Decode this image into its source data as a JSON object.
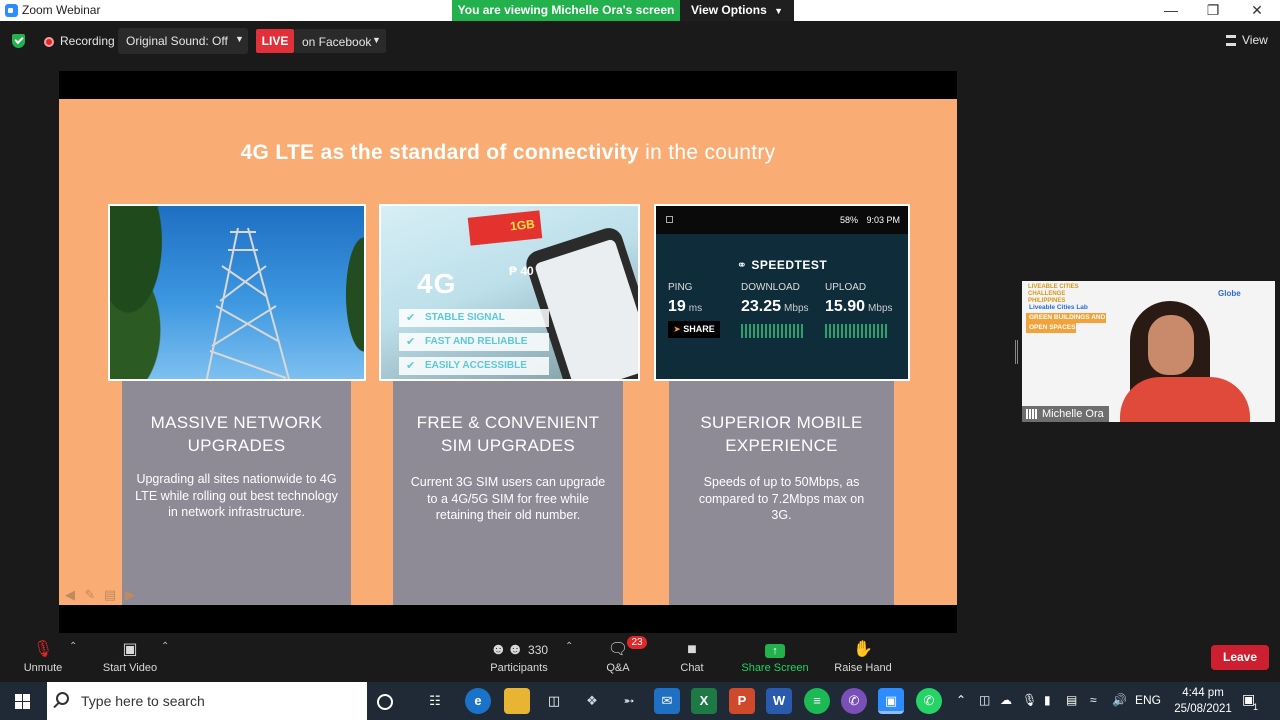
{
  "window": {
    "title": "Zoom Webinar",
    "viewing_banner": "You are viewing Michelle Ora's screen",
    "view_options": "View Options",
    "minimize": "—",
    "restore": "❐",
    "close": "✕"
  },
  "topbar": {
    "recording": "Recording",
    "original_sound": "Original Sound: Off",
    "live": "LIVE",
    "live_destination": "on Facebook",
    "view": "View"
  },
  "slide": {
    "title_bold": "4G LTE as the standard of connectivity",
    "title_light": " in the country",
    "sim_art": {
      "data_tag": "1GB",
      "price": "₱ 40",
      "big": "4G",
      "checks": [
        "STABLE SIGNAL",
        "FAST AND RELIABLE",
        "EASILY ACCESSIBLE"
      ]
    },
    "speedtest": {
      "battery": "58%",
      "time": "9:03 PM",
      "brand": "SPEEDTEST",
      "ping_label": "PING",
      "ping_value": "19",
      "ping_unit": "ms",
      "download_label": "DOWNLOAD",
      "download_value": "23.25",
      "download_unit": "Mbps",
      "upload_label": "UPLOAD",
      "upload_value": "15.90",
      "upload_unit": "Mbps",
      "share": "SHARE"
    },
    "cards": [
      {
        "title_line1": "MASSIVE NETWORK",
        "title_line2": "UPGRADES",
        "desc": "Upgrading all sites nationwide to 4G LTE while rolling out best technology in network infrastructure."
      },
      {
        "title_line1": "FREE & CONVENIENT",
        "title_line2": "SIM UPGRADES",
        "desc": "Current 3G SIM users can upgrade to a 4G/5G SIM for free while retaining their old number."
      },
      {
        "title_line1": "SUPERIOR MOBILE",
        "title_line2": "EXPERIENCE",
        "desc": "Speeds of up to 50Mbps, as compared to 7.2Mbps max on 3G."
      }
    ]
  },
  "camera": {
    "name": "Michelle Ora",
    "logo_text": "LIVEABLE CITIES CHALLENGE PHILIPPINES",
    "tag1": "Liveable Cities Lab",
    "tag2": "GREEN BUILDINGS AND",
    "tag3": "OPEN SPACES",
    "sponsor": "Globe"
  },
  "toolbar": {
    "unmute": "Unmute",
    "start_video": "Start Video",
    "participants_count": "330",
    "participants": "Participants",
    "qa_badge": "23",
    "qa": "Q&A",
    "chat": "Chat",
    "share_screen": "Share Screen",
    "raise_hand": "Raise Hand",
    "leave": "Leave"
  },
  "taskbar": {
    "search_placeholder": "Type here to search",
    "language": "ENG",
    "time": "4:44 pm",
    "date": "25/08/2021",
    "notifications": "1"
  }
}
